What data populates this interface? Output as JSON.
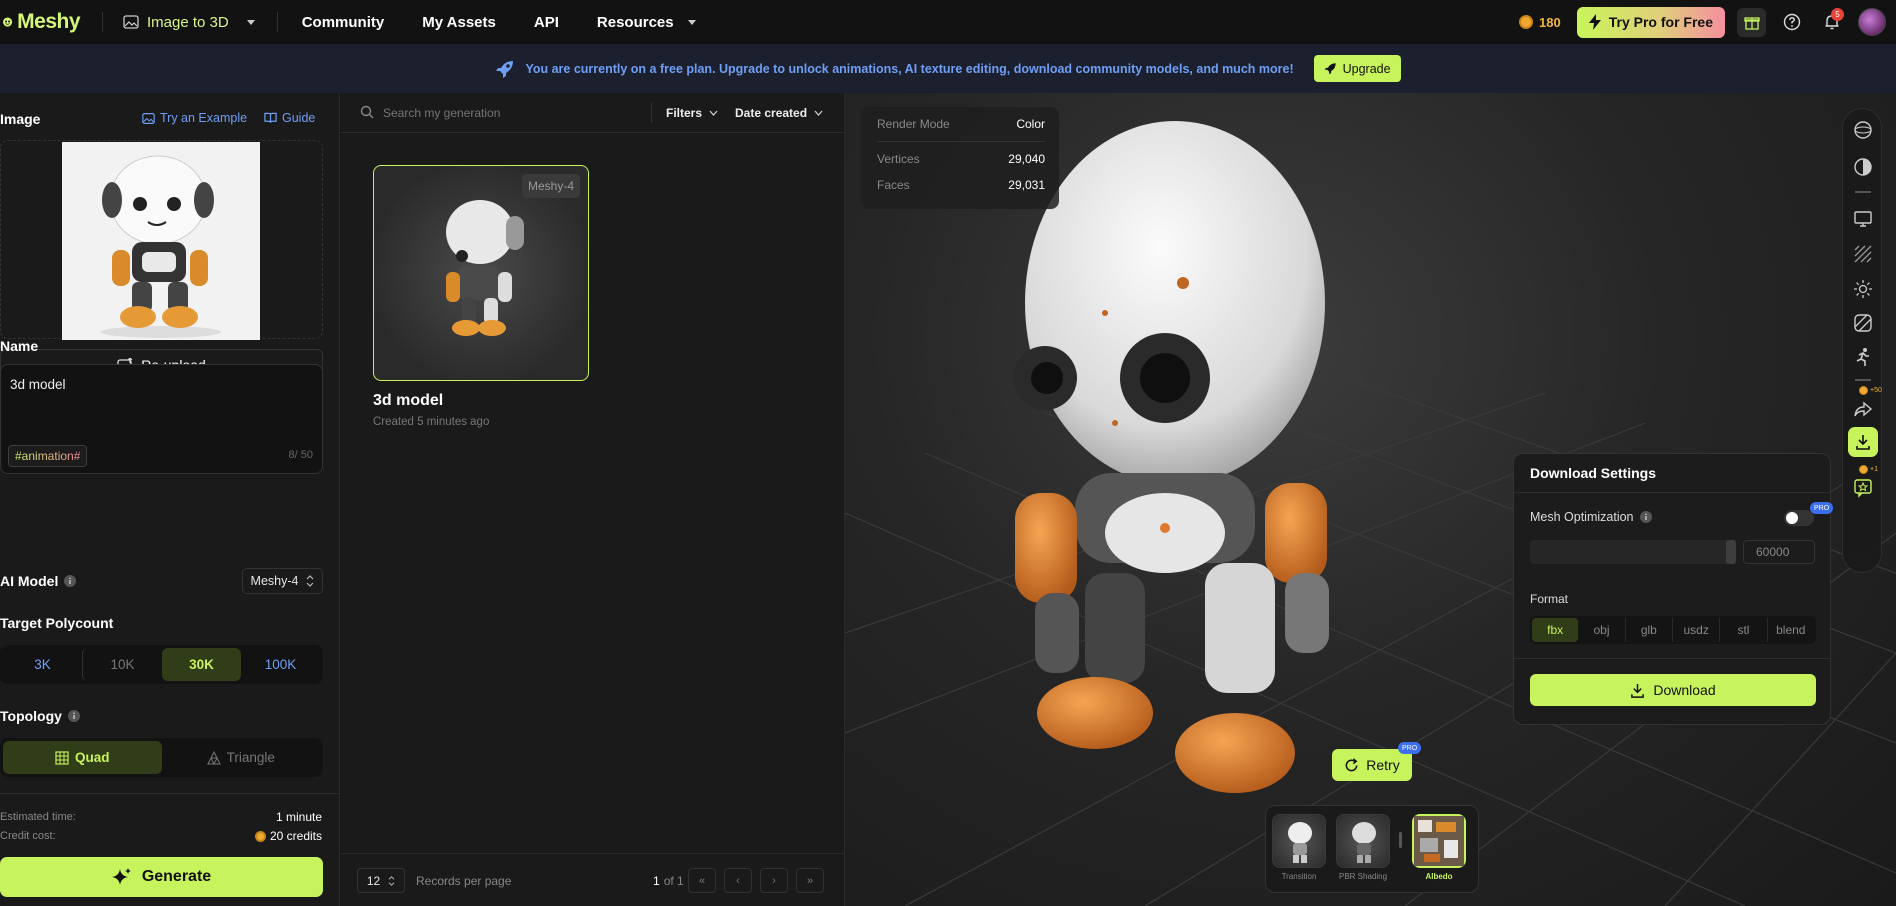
{
  "header": {
    "brand": "Meshy",
    "mode": "Image to 3D",
    "nav": [
      "Community",
      "My Assets",
      "API",
      "Resources"
    ],
    "credits": "180",
    "try_pro": "Try Pro for Free",
    "notification_count": "5"
  },
  "banner": {
    "text": "You are currently on a free plan. Upgrade to unlock animations, AI texture editing, download community models, and much more!",
    "upgrade": "Upgrade"
  },
  "left": {
    "image_label": "Image",
    "try_example": "Try an Example",
    "guide": "Guide",
    "reupload": "Re-upload",
    "name_label": "Name",
    "name_value": "3d model",
    "tag": "#animation#",
    "char_count": "8/ 50",
    "ai_model_label": "AI Model",
    "ai_model_value": "Meshy-4",
    "polycount_label": "Target Polycount",
    "polycount_options": [
      "3K",
      "10K",
      "30K",
      "100K"
    ],
    "polycount_selected": "30K",
    "topology_label": "Topology",
    "topology_options": [
      "Quad",
      "Triangle"
    ],
    "topology_selected": "Quad",
    "est_time_label": "Estimated time:",
    "est_time_value": "1 minute",
    "credit_cost_label": "Credit cost:",
    "credit_cost_value": "20 credits",
    "generate": "Generate"
  },
  "middle": {
    "search_placeholder": "Search my generation",
    "filters": "Filters",
    "sort": "Date created",
    "card": {
      "badge": "Meshy-4",
      "title": "3d model",
      "subtitle": "Created 5 minutes ago"
    },
    "per_page": "12",
    "per_page_label": "Records per page",
    "page_current": "1",
    "page_of": "of 1"
  },
  "viewport": {
    "stats": {
      "render_mode_label": "Render Mode",
      "render_mode_value": "Color",
      "vertices_label": "Vertices",
      "vertices_value": "29,040",
      "faces_label": "Faces",
      "faces_value": "29,031"
    },
    "download": {
      "title": "Download Settings",
      "mesh_opt_label": "Mesh Optimization",
      "mesh_value": "60000",
      "format_label": "Format",
      "formats": [
        "fbx",
        "obj",
        "glb",
        "usdz",
        "stl",
        "blend"
      ],
      "format_selected": "fbx",
      "button": "Download",
      "pro": "PRO"
    },
    "share_bonus": "+50",
    "feedback_bonus": "+1",
    "retry": "Retry",
    "materials": [
      "Transition",
      "PBR Shading",
      "Albedo"
    ],
    "material_selected": "Albedo"
  }
}
